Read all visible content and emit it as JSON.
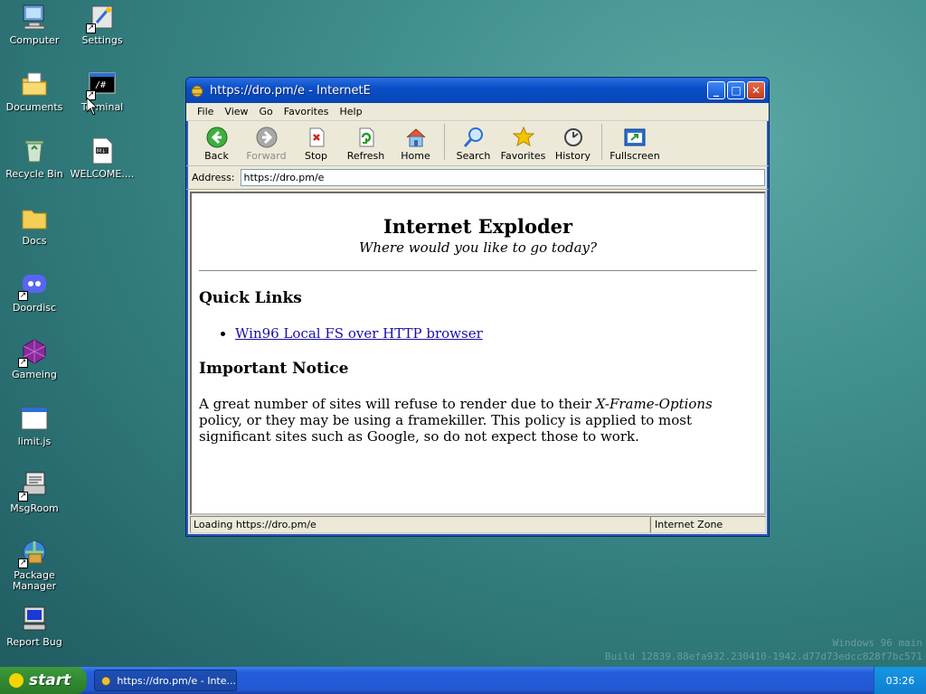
{
  "desktop": {
    "icons": [
      {
        "label": "Computer",
        "icon": "computer-icon"
      },
      {
        "label": "Settings",
        "icon": "settings-icon"
      },
      {
        "label": "Documents",
        "icon": "documents-icon"
      },
      {
        "label": "Terminal",
        "icon": "terminal-icon"
      },
      {
        "label": "Recycle Bin",
        "icon": "recycle-bin-icon"
      },
      {
        "label": "WELCOME....",
        "icon": "welcome-file-icon"
      },
      {
        "label": "Docs",
        "icon": "folder-icon"
      },
      {
        "label": "Doordisc",
        "icon": "doordisc-icon"
      },
      {
        "label": "Gameing",
        "icon": "gameing-icon"
      },
      {
        "label": "limit.js",
        "icon": "js-file-icon"
      },
      {
        "label": "MsgRoom",
        "icon": "msgroom-icon"
      },
      {
        "label": "Package Manager",
        "icon": "package-manager-icon"
      },
      {
        "label": "Report Bug",
        "icon": "report-bug-icon"
      }
    ],
    "watermark_line1": "Windows 96 main",
    "watermark_line2": "Build 12839.88efa932.230410-1942.d77d73edcc828f7bc571"
  },
  "window": {
    "title": "https://dro.pm/e - InternetE",
    "menu": [
      "File",
      "View",
      "Go",
      "Favorites",
      "Help"
    ],
    "toolbar": {
      "back": "Back",
      "forward": "Forward",
      "stop": "Stop",
      "refresh": "Refresh",
      "home": "Home",
      "search": "Search",
      "favorites": "Favorites",
      "history": "History",
      "fullscreen": "Fullscreen"
    },
    "address_label": "Address:",
    "address_value": "https://dro.pm/e",
    "status_text": "Loading https://dro.pm/e",
    "status_zone": "Internet Zone"
  },
  "page": {
    "title": "Internet Exploder",
    "tagline": "Where would you like to go today?",
    "quick_links_heading": "Quick Links",
    "link1": "Win96 Local FS over HTTP browser",
    "notice_heading": "Important Notice",
    "notice_pre": "A great number of sites will refuse to render due to their ",
    "notice_em": "X-Frame-Options",
    "notice_post": " policy, or they may be using a framekiller. This policy is applied to most significant sites such as Google, so do not expect those to work."
  },
  "taskbar": {
    "start_label": "start",
    "task_label": "https://dro.pm/e - Inte...",
    "clock": "03:26"
  },
  "colors": {
    "taskbar": "#245edb",
    "start": "#318a31",
    "titlebar": "#0a4fc8"
  }
}
